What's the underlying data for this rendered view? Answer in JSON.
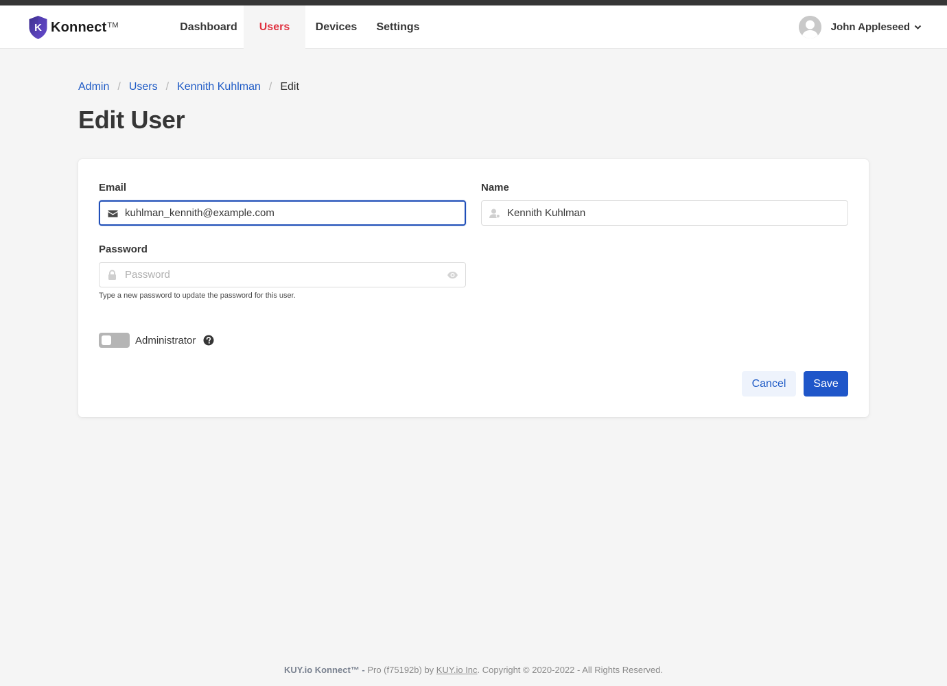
{
  "brand": {
    "name": "Konnect",
    "trademark": "TM",
    "logo_letter": "K",
    "shield_colors": [
      "#3d2f8e",
      "#6b4fd1"
    ]
  },
  "nav": {
    "items": [
      {
        "label": "Dashboard",
        "active": false
      },
      {
        "label": "Users",
        "active": true
      },
      {
        "label": "Devices",
        "active": false
      },
      {
        "label": "Settings",
        "active": false
      }
    ],
    "active_color": "#e0313f"
  },
  "user_menu": {
    "name": "John Appleseed",
    "avatar_icon": "user-avatar-icon",
    "dropdown_icon": "chevron-down-icon"
  },
  "breadcrumb": {
    "items": [
      {
        "label": "Admin",
        "link": true
      },
      {
        "label": "Users",
        "link": true
      },
      {
        "label": "Kennith Kuhlman",
        "link": true
      },
      {
        "label": "Edit",
        "link": false
      }
    ],
    "separator": "/"
  },
  "page_title": "Edit User",
  "form": {
    "email": {
      "label": "Email",
      "value": "kuhlman_kennith@example.com",
      "icon": "envelope-icon",
      "focused": true
    },
    "name": {
      "label": "Name",
      "value": "Kennith Kuhlman",
      "icon": "user-icon"
    },
    "password": {
      "label": "Password",
      "value": "",
      "placeholder": "Password",
      "icon": "lock-icon",
      "reveal_icon": "eye-icon",
      "help": "Type a new password to update the password for this user."
    },
    "administrator": {
      "label": "Administrator",
      "enabled": false,
      "help_icon": "question-circle-icon"
    },
    "cancel_label": "Cancel",
    "save_label": "Save"
  },
  "footer": {
    "brand": "KUY.io Konnect™ - ",
    "text_before_link": "Pro (f75192b) by ",
    "link": "KUY.io Inc",
    "text_after_link": ". Copyright © 2020-2022 - All Rights Reserved."
  },
  "colors": {
    "primary": "#1f56c9",
    "link": "#1f5bc6",
    "background": "#f5f5f5",
    "topbar": "#363636"
  }
}
